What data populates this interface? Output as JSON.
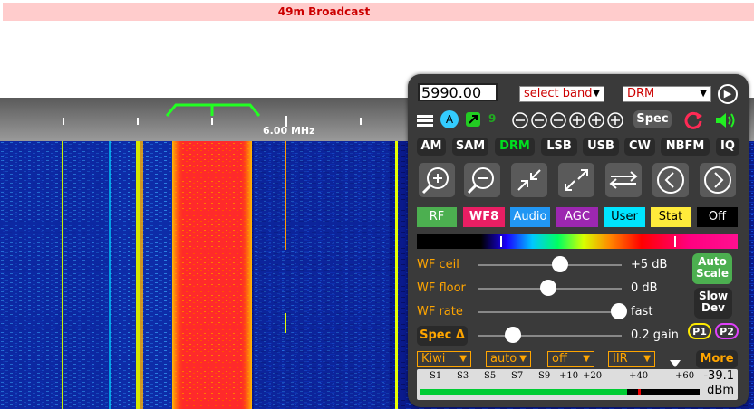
{
  "band_title": "49m Broadcast",
  "scale": {
    "freq_label": "6.00 MHz"
  },
  "controls": {
    "frequency_value": "5990.00",
    "band_select": "select band",
    "mode_select": "DRM",
    "icons_row": {
      "menu_icon": "hamburger-menu-icon",
      "a_label": "A",
      "nine_label": "9",
      "spec_label": "Spec"
    },
    "modes": [
      "AM",
      "SAM",
      "DRM",
      "LSB",
      "USB",
      "CW",
      "NBFM",
      "IQ"
    ],
    "active_mode": "DRM",
    "tabs": [
      {
        "label": "RF",
        "bg": "#4caf50",
        "color": "#ffffff"
      },
      {
        "label": "WF8",
        "bg": "#e91e63",
        "color": "#ffffff"
      },
      {
        "label": "Audio",
        "bg": "#2196f3",
        "color": "#ffffff"
      },
      {
        "label": "AGC",
        "bg": "#9c27b0",
        "color": "#ffffff"
      },
      {
        "label": "User",
        "bg": "#00e5ff",
        "color": "#000000"
      },
      {
        "label": "Stat",
        "bg": "#ffeb3b",
        "color": "#000000"
      },
      {
        "label": "Off",
        "bg": "#000000",
        "color": "#ffffff"
      }
    ],
    "wf_ceil_label": "WF ceil",
    "wf_ceil_value": "+5 dB",
    "wf_ceil_level": 0.57,
    "wf_floor_label": "WF floor",
    "wf_floor_value": "0 dB",
    "wf_floor_level": 0.49,
    "wf_rate_label": "WF rate",
    "wf_rate_value": "fast",
    "wf_rate_level": 0.98,
    "spec_delta_label": "Spec Δ",
    "gain_value": "0.2 gain",
    "gain_level": 0.24,
    "auto_scale_label": [
      "Auto",
      "Scale"
    ],
    "slow_dev_label": [
      "Slow",
      "Dev"
    ],
    "p1_label": "P1",
    "p2_label": "P2",
    "bottom_selects": [
      "Kiwi",
      "auto",
      "off",
      "IIR"
    ],
    "more_label": "More",
    "smeter_labels": [
      "S1",
      "S3",
      "S5",
      "S7",
      "S9",
      "+10",
      "+20",
      "+40",
      "+60"
    ],
    "dbm_value": "-39.1",
    "dbm_unit": "dBm",
    "signal_fraction": 0.74
  }
}
